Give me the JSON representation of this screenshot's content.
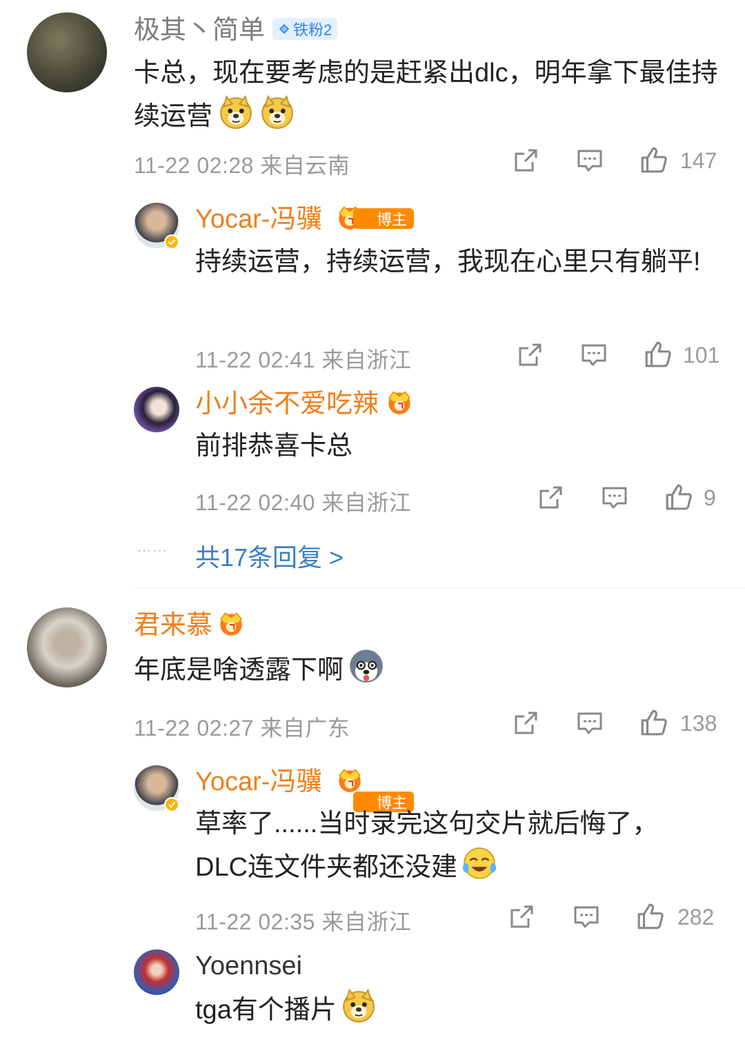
{
  "comments": [
    {
      "user": "极其丶简单",
      "badge": "铁粉2",
      "text": "卡总，现在要考虑的是赶紧出dlc，明年拿下最佳持续运营",
      "time": "11-22 02:28 来自云南",
      "likes": "147",
      "replies": [
        {
          "user": "Yocar-冯骥",
          "badge": "博主",
          "text": "持续运营，持续运营，我现在心里只有躺平!",
          "time": "11-22 02:41 来自浙江",
          "likes": "101"
        },
        {
          "user": "小小余不爱吃辣",
          "text": "前排恭喜卡总",
          "time": "11-22 02:40 来自浙江",
          "likes": "9"
        }
      ],
      "more_dots": "……",
      "more_replies": "共17条回复 >"
    },
    {
      "user": "君来慕",
      "text": "年底是啥透露下啊",
      "time": "11-22 02:27 来自广东",
      "likes": "138",
      "replies": [
        {
          "user": "Yocar-冯骥",
          "badge": "博主",
          "text_line1": "草率了......当时录完这句交片就后悔了，",
          "text_line2": "DLC连文件夹都还没建",
          "time": "11-22 02:35 来自浙江",
          "likes": "282"
        },
        {
          "user": "Yoennsei",
          "text": "tga有个播片"
        }
      ]
    }
  ],
  "icons": {
    "share": "share-icon",
    "comment": "comment-icon",
    "like": "thumbs-up-icon",
    "doge": "doge-emoji",
    "crown": "crown-icon",
    "verified": "verified-icon",
    "diamond": "diamond-icon"
  },
  "colors": {
    "orange_name": "#ef7f1a",
    "link_blue": "#3a7ec9",
    "meta_gray": "#9a9a9a",
    "iron_badge": "#2f86e8",
    "boss_badge": "#ff8a00"
  }
}
